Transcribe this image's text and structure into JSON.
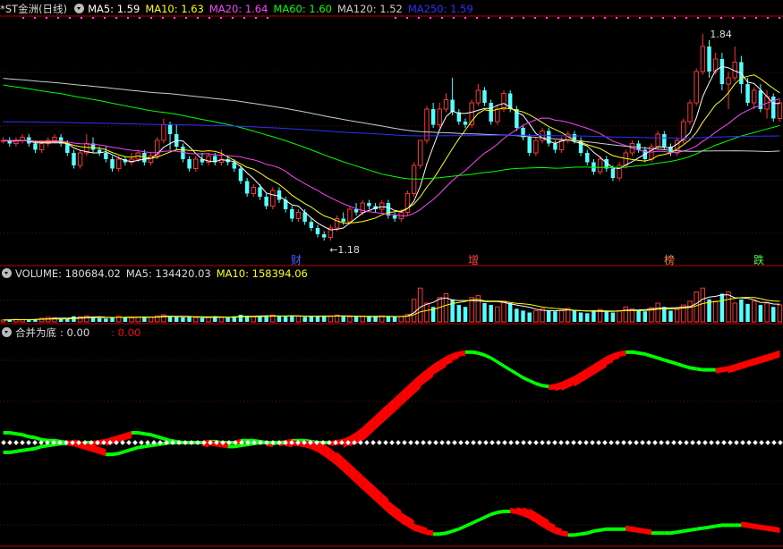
{
  "price_panel": {
    "title": "*ST金洲(日线)",
    "ma5_label": "MA5: 1.59",
    "ma10_label": "MA10: 1.63",
    "ma20_label": "MA20: 1.64",
    "ma60_label": "MA60: 1.60",
    "ma120_label": "MA120: 1.52",
    "ma250_label": "MA250: 1.59",
    "high_label": "1.84",
    "low_label": "←1.18",
    "event_labels": [
      "财",
      "增",
      "榜",
      "跌"
    ],
    "colors": {
      "up": "#ff3232",
      "down": "#54ffff",
      "ma5": "#ffffff",
      "ma10": "#ffff00",
      "ma20": "#ff40ff",
      "ma60": "#00ff00",
      "ma120": "#cccccc",
      "ma250": "#3030ff"
    }
  },
  "volume_panel": {
    "label_volume": "VOLUME: 180684.02",
    "label_ma5": "MA5: 134420.03",
    "label_ma10": "MA10: 158394.06"
  },
  "indicator_panel": {
    "name": "合并为底",
    "value1": ": 0.00",
    "value2": ": 0.00",
    "colors": {
      "green": "#00ff00",
      "red": "#ff0000"
    }
  },
  "chart_data": [
    {
      "type": "candlestick",
      "panel": "price",
      "ylim": [
        1.12,
        1.88
      ],
      "high": {
        "value": 1.84
      },
      "low": {
        "value": 1.18
      },
      "ohlc": [
        [
          1.5,
          1.5,
          1.49,
          1.51
        ],
        [
          1.5,
          1.49,
          1.48,
          1.51
        ],
        [
          1.49,
          1.5,
          1.48,
          1.51
        ],
        [
          1.5,
          1.51,
          1.49,
          1.52
        ],
        [
          1.51,
          1.49,
          1.48,
          1.52
        ],
        [
          1.49,
          1.47,
          1.46,
          1.5
        ],
        [
          1.47,
          1.49,
          1.46,
          1.5
        ],
        [
          1.49,
          1.5,
          1.48,
          1.51
        ],
        [
          1.5,
          1.51,
          1.49,
          1.52
        ],
        [
          1.51,
          1.49,
          1.48,
          1.52
        ],
        [
          1.49,
          1.46,
          1.45,
          1.5
        ],
        [
          1.46,
          1.42,
          1.41,
          1.47
        ],
        [
          1.42,
          1.46,
          1.41,
          1.47
        ],
        [
          1.46,
          1.49,
          1.45,
          1.52
        ],
        [
          1.49,
          1.47,
          1.46,
          1.51
        ],
        [
          1.47,
          1.46,
          1.45,
          1.48
        ],
        [
          1.46,
          1.44,
          1.43,
          1.48
        ],
        [
          1.44,
          1.41,
          1.4,
          1.45
        ],
        [
          1.41,
          1.44,
          1.4,
          1.45
        ],
        [
          1.44,
          1.43,
          1.42,
          1.45
        ],
        [
          1.43,
          1.44,
          1.42,
          1.46
        ],
        [
          1.44,
          1.46,
          1.43,
          1.47
        ],
        [
          1.46,
          1.43,
          1.42,
          1.47
        ],
        [
          1.43,
          1.45,
          1.42,
          1.46
        ],
        [
          1.45,
          1.5,
          1.44,
          1.51
        ],
        [
          1.5,
          1.55,
          1.49,
          1.57
        ],
        [
          1.55,
          1.52,
          1.47,
          1.56
        ],
        [
          1.52,
          1.48,
          1.47,
          1.55
        ],
        [
          1.48,
          1.44,
          1.43,
          1.49
        ],
        [
          1.44,
          1.41,
          1.4,
          1.45
        ],
        [
          1.41,
          1.44,
          1.4,
          1.45
        ],
        [
          1.44,
          1.43,
          1.42,
          1.46
        ],
        [
          1.43,
          1.45,
          1.42,
          1.46
        ],
        [
          1.45,
          1.43,
          1.42,
          1.46
        ],
        [
          1.43,
          1.44,
          1.42,
          1.47
        ],
        [
          1.44,
          1.43,
          1.42,
          1.45
        ],
        [
          1.43,
          1.41,
          1.4,
          1.44
        ],
        [
          1.41,
          1.37,
          1.36,
          1.42
        ],
        [
          1.37,
          1.33,
          1.32,
          1.38
        ],
        [
          1.33,
          1.35,
          1.32,
          1.36
        ],
        [
          1.35,
          1.32,
          1.31,
          1.36
        ],
        [
          1.32,
          1.29,
          1.28,
          1.33
        ],
        [
          1.29,
          1.34,
          1.28,
          1.35
        ],
        [
          1.34,
          1.31,
          1.3,
          1.35
        ],
        [
          1.31,
          1.28,
          1.27,
          1.32
        ],
        [
          1.28,
          1.25,
          1.24,
          1.29
        ],
        [
          1.25,
          1.27,
          1.24,
          1.28
        ],
        [
          1.27,
          1.24,
          1.23,
          1.28
        ],
        [
          1.24,
          1.22,
          1.21,
          1.25
        ],
        [
          1.22,
          1.2,
          1.19,
          1.23
        ],
        [
          1.2,
          1.19,
          1.18,
          1.21
        ],
        [
          1.19,
          1.22,
          1.18,
          1.23
        ],
        [
          1.22,
          1.25,
          1.21,
          1.26
        ],
        [
          1.25,
          1.24,
          1.23,
          1.27
        ],
        [
          1.24,
          1.28,
          1.23,
          1.29
        ],
        [
          1.28,
          1.27,
          1.26,
          1.3
        ],
        [
          1.27,
          1.3,
          1.26,
          1.31
        ],
        [
          1.3,
          1.29,
          1.28,
          1.31
        ],
        [
          1.29,
          1.28,
          1.27,
          1.3
        ],
        [
          1.28,
          1.3,
          1.27,
          1.31
        ],
        [
          1.3,
          1.26,
          1.25,
          1.31
        ],
        [
          1.26,
          1.25,
          1.24,
          1.27
        ],
        [
          1.25,
          1.27,
          1.24,
          1.28
        ],
        [
          1.27,
          1.33,
          1.26,
          1.34
        ],
        [
          1.33,
          1.42,
          1.32,
          1.43
        ],
        [
          1.42,
          1.5,
          1.41,
          1.5
        ],
        [
          1.5,
          1.6,
          1.49,
          1.61
        ],
        [
          1.6,
          1.55,
          1.54,
          1.62
        ],
        [
          1.55,
          1.6,
          1.54,
          1.62
        ],
        [
          1.6,
          1.63,
          1.59,
          1.65
        ],
        [
          1.63,
          1.59,
          1.58,
          1.7
        ],
        [
          1.59,
          1.56,
          1.55,
          1.6
        ],
        [
          1.56,
          1.55,
          1.54,
          1.57
        ],
        [
          1.55,
          1.62,
          1.54,
          1.63
        ],
        [
          1.62,
          1.66,
          1.61,
          1.68
        ],
        [
          1.66,
          1.62,
          1.61,
          1.67
        ],
        [
          1.62,
          1.56,
          1.55,
          1.63
        ],
        [
          1.56,
          1.6,
          1.55,
          1.61
        ],
        [
          1.6,
          1.65,
          1.59,
          1.66
        ],
        [
          1.65,
          1.6,
          1.59,
          1.66
        ],
        [
          1.6,
          1.54,
          1.53,
          1.61
        ],
        [
          1.54,
          1.51,
          1.5,
          1.55
        ],
        [
          1.51,
          1.46,
          1.45,
          1.52
        ],
        [
          1.46,
          1.5,
          1.45,
          1.51
        ],
        [
          1.5,
          1.53,
          1.49,
          1.54
        ],
        [
          1.53,
          1.49,
          1.48,
          1.54
        ],
        [
          1.49,
          1.47,
          1.46,
          1.5
        ],
        [
          1.47,
          1.5,
          1.46,
          1.51
        ],
        [
          1.5,
          1.52,
          1.49,
          1.53
        ],
        [
          1.52,
          1.5,
          1.49,
          1.53
        ],
        [
          1.5,
          1.46,
          1.45,
          1.51
        ],
        [
          1.46,
          1.43,
          1.42,
          1.47
        ],
        [
          1.43,
          1.4,
          1.39,
          1.44
        ],
        [
          1.4,
          1.44,
          1.39,
          1.45
        ],
        [
          1.44,
          1.41,
          1.4,
          1.45
        ],
        [
          1.41,
          1.38,
          1.37,
          1.42
        ],
        [
          1.38,
          1.42,
          1.37,
          1.43
        ],
        [
          1.42,
          1.46,
          1.41,
          1.47
        ],
        [
          1.46,
          1.49,
          1.45,
          1.5
        ],
        [
          1.49,
          1.47,
          1.46,
          1.5
        ],
        [
          1.47,
          1.44,
          1.43,
          1.48
        ],
        [
          1.44,
          1.48,
          1.43,
          1.49
        ],
        [
          1.48,
          1.52,
          1.47,
          1.53
        ],
        [
          1.52,
          1.48,
          1.47,
          1.53
        ],
        [
          1.48,
          1.46,
          1.45,
          1.49
        ],
        [
          1.46,
          1.5,
          1.45,
          1.51
        ],
        [
          1.5,
          1.56,
          1.49,
          1.57
        ],
        [
          1.56,
          1.62,
          1.55,
          1.63
        ],
        [
          1.62,
          1.72,
          1.61,
          1.73
        ],
        [
          1.72,
          1.8,
          1.71,
          1.84
        ],
        [
          1.8,
          1.72,
          1.7,
          1.82
        ],
        [
          1.72,
          1.76,
          1.71,
          1.78
        ],
        [
          1.76,
          1.68,
          1.66,
          1.78
        ],
        [
          1.68,
          1.7,
          1.6,
          1.72
        ],
        [
          1.7,
          1.75,
          1.69,
          1.8
        ],
        [
          1.75,
          1.68,
          1.65,
          1.77
        ],
        [
          1.68,
          1.62,
          1.61,
          1.7
        ],
        [
          1.62,
          1.66,
          1.6,
          1.67
        ],
        [
          1.66,
          1.6,
          1.59,
          1.68
        ],
        [
          1.6,
          1.64,
          1.57,
          1.66
        ],
        [
          1.64,
          1.57,
          1.56,
          1.65
        ],
        [
          1.57,
          1.62,
          1.56,
          1.63
        ]
      ],
      "moving_averages": [
        "MA5",
        "MA10",
        "MA20",
        "MA60",
        "MA120",
        "MA250"
      ],
      "events": [
        "财",
        "增",
        "榜",
        "跌"
      ]
    },
    {
      "type": "bar",
      "panel": "volume",
      "ylim": [
        0,
        200000
      ],
      "values": [
        10000,
        12000,
        14000,
        11000,
        13000,
        15000,
        20000,
        25000,
        22000,
        15000,
        16000,
        30000,
        28000,
        32000,
        26000,
        20000,
        18000,
        24000,
        30000,
        26000,
        22000,
        25000,
        28000,
        24000,
        32000,
        38000,
        30000,
        26000,
        24000,
        28000,
        22000,
        20000,
        24000,
        30000,
        26000,
        22000,
        30000,
        38000,
        32000,
        28000,
        30000,
        34000,
        36000,
        30000,
        28000,
        34000,
        30000,
        26000,
        28000,
        30000,
        34000,
        32000,
        36000,
        30000,
        26000,
        28000,
        30000,
        26000,
        28000,
        32000,
        28000,
        26000,
        30000,
        40000,
        120000,
        180000,
        100000,
        80000,
        130000,
        150000,
        120000,
        90000,
        80000,
        130000,
        140000,
        100000,
        90000,
        80000,
        110000,
        100000,
        70000,
        60000,
        50000,
        60000,
        70000,
        60000,
        56000,
        60000,
        72000,
        60000,
        50000,
        46000,
        60000,
        66000,
        56000,
        50000,
        60000,
        80000,
        70000,
        60000,
        56000,
        76000,
        100000,
        80000,
        60000,
        66000,
        90000,
        110000,
        160000,
        180000,
        120000,
        110000,
        150000,
        160000,
        100000,
        120000,
        96000,
        110000,
        90000,
        100000,
        80000,
        90000
      ],
      "labels": [
        "VOLUME: 180684.02",
        "MA5: 134420.03",
        "MA10: 158394.06"
      ]
    },
    {
      "type": "area",
      "panel": "indicator",
      "name": "合并为底",
      "ylim": [
        -1,
        1
      ],
      "series": [
        {
          "role": "upper",
          "values": [
            0.1,
            0.1,
            0.09,
            0.08,
            0.06,
            0.05,
            0.03,
            0.02,
            0.02,
            0.01,
            0,
            0,
            -0.01,
            0,
            0,
            0.01,
            0.02,
            0.04,
            0.06,
            0.08,
            0.1,
            0.1,
            0.09,
            0.08,
            0.06,
            0.04,
            0.02,
            0.01,
            0,
            0,
            0,
            0,
            0.01,
            0.01,
            0,
            0,
            0,
            0.02,
            0.02,
            0.02,
            0.01,
            0,
            -0.01,
            0,
            0.01,
            0.02,
            0.02,
            0.02,
            0.01,
            0,
            0,
            0,
            0.01,
            0.02,
            0.05,
            0.09,
            0.14,
            0.2,
            0.26,
            0.32,
            0.38,
            0.44,
            0.5,
            0.56,
            0.62,
            0.68,
            0.73,
            0.78,
            0.82,
            0.86,
            0.89,
            0.91,
            0.92,
            0.92,
            0.91,
            0.89,
            0.86,
            0.82,
            0.78,
            0.74,
            0.7,
            0.66,
            0.63,
            0.6,
            0.58,
            0.57,
            0.58,
            0.6,
            0.63,
            0.66,
            0.7,
            0.74,
            0.78,
            0.82,
            0.86,
            0.89,
            0.91,
            0.92,
            0.92,
            0.91,
            0.9,
            0.88,
            0.86,
            0.84,
            0.82,
            0.8,
            0.78,
            0.76,
            0.75,
            0.74,
            0.74,
            0.74,
            0.75,
            0.76,
            0.78,
            0.8,
            0.82,
            0.84,
            0.86,
            0.88,
            0.9,
            0.92
          ]
        },
        {
          "role": "lower",
          "values": [
            -0.1,
            -0.1,
            -0.09,
            -0.08,
            -0.07,
            -0.06,
            -0.04,
            -0.03,
            -0.02,
            -0.01,
            -0.01,
            -0.02,
            -0.04,
            -0.06,
            -0.08,
            -0.1,
            -0.12,
            -0.12,
            -0.11,
            -0.09,
            -0.07,
            -0.05,
            -0.04,
            -0.03,
            -0.02,
            -0.01,
            0,
            0,
            0,
            0,
            0,
            0,
            -0.01,
            -0.02,
            -0.03,
            -0.04,
            -0.04,
            -0.03,
            -0.02,
            -0.01,
            0,
            0,
            0,
            0,
            0,
            -0.01,
            -0.02,
            -0.03,
            -0.05,
            -0.08,
            -0.12,
            -0.17,
            -0.22,
            -0.28,
            -0.34,
            -0.4,
            -0.46,
            -0.52,
            -0.58,
            -0.64,
            -0.7,
            -0.75,
            -0.8,
            -0.84,
            -0.88,
            -0.9,
            -0.92,
            -0.93,
            -0.93,
            -0.92,
            -0.9,
            -0.88,
            -0.85,
            -0.82,
            -0.79,
            -0.76,
            -0.73,
            -0.71,
            -0.7,
            -0.7,
            -0.71,
            -0.73,
            -0.76,
            -0.8,
            -0.84,
            -0.88,
            -0.91,
            -0.93,
            -0.94,
            -0.94,
            -0.93,
            -0.92,
            -0.9,
            -0.89,
            -0.88,
            -0.88,
            -0.88,
            -0.88,
            -0.89,
            -0.9,
            -0.91,
            -0.92,
            -0.92,
            -0.92,
            -0.92,
            -0.91,
            -0.9,
            -0.89,
            -0.88,
            -0.87,
            -0.86,
            -0.85,
            -0.84,
            -0.84,
            -0.84,
            -0.84,
            -0.85,
            -0.86,
            -0.87,
            -0.88,
            -0.89,
            -0.9
          ]
        }
      ]
    }
  ]
}
